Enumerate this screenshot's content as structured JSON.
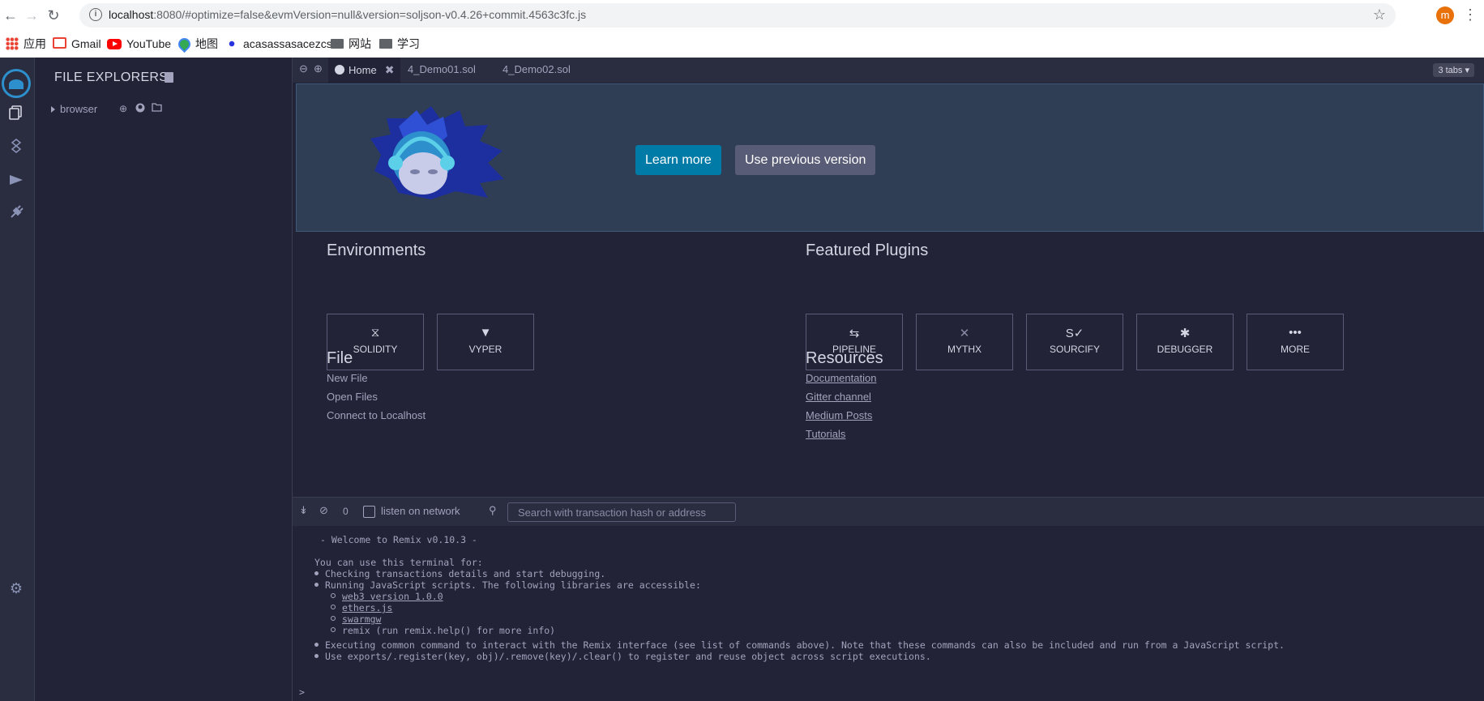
{
  "browser": {
    "url_host": "localhost",
    "url_rest": ":8080/#optimize=false&evmVersion=null&version=soljson-v0.4.26+commit.4563c3fc.js",
    "profile_initial": "m",
    "bookmarks": [
      {
        "label": "应用",
        "icon": "apps-icon"
      },
      {
        "label": "Gmail",
        "icon": "gmail-icon"
      },
      {
        "label": "YouTube",
        "icon": "youtube-icon"
      },
      {
        "label": "地图",
        "icon": "maps-icon"
      },
      {
        "label": "acasassasacezcs",
        "icon": "baidu-icon"
      },
      {
        "label": "网站",
        "icon": "folder-icon"
      },
      {
        "label": "学习",
        "icon": "folder-icon"
      }
    ]
  },
  "side_panel": {
    "title": "FILE EXPLORERS",
    "tree_root": "browser"
  },
  "tabs": {
    "items": [
      {
        "label": "Home",
        "active": true
      },
      {
        "label": "4_Demo01.sol",
        "active": false
      },
      {
        "label": "4_Demo02.sol",
        "active": false
      }
    ],
    "count_label": "3 tabs"
  },
  "banner": {
    "learn_more": "Learn more",
    "previous_version": "Use previous version"
  },
  "environments": {
    "title": "Environments",
    "items": [
      {
        "label": "SOLIDITY",
        "icon": "solidity-icon"
      },
      {
        "label": "VYPER",
        "icon": "vyper-icon"
      }
    ]
  },
  "featured": {
    "title": "Featured Plugins",
    "items": [
      {
        "label": "PIPELINE",
        "icon": "pipeline-icon"
      },
      {
        "label": "MYTHX",
        "icon": "mythx-icon"
      },
      {
        "label": "SOURCIFY",
        "icon": "sourcify-icon"
      },
      {
        "label": "DEBUGGER",
        "icon": "bug-icon"
      },
      {
        "label": "MORE",
        "icon": "more-icon"
      }
    ]
  },
  "file_section": {
    "title": "File",
    "links": [
      "New File",
      "Open Files",
      "Connect to Localhost"
    ]
  },
  "resources": {
    "title": "Resources",
    "links": [
      "Documentation",
      "Gitter channel",
      "Medium Posts",
      "Tutorials"
    ]
  },
  "terminal": {
    "pending_count": "0",
    "listen_label": "listen on network",
    "search_placeholder": "Search with transaction hash or address",
    "welcome": "- Welcome to Remix v0.10.3 -",
    "intro": "You can use this terminal for:",
    "bullets": [
      "Checking transactions details and start debugging.",
      "Running JavaScript scripts. The following libraries are accessible:"
    ],
    "libraries": [
      "web3 version 1.0.0",
      "ethers.js",
      "swarmgw",
      "remix (run remix.help() for more info)"
    ],
    "bullets2": [
      "Executing common command to interact with the Remix interface (see list of commands above). Note that these commands can also be included and run from a JavaScript script.",
      "Use exports/.register(key, obj)/.remove(key)/.clear() to register and reuse object across script executions."
    ],
    "prompt": ">"
  },
  "colors": {
    "accent": "#007aa6",
    "background": "#222336",
    "panel": "#2a2c3f",
    "banner": "#2f3e55"
  }
}
